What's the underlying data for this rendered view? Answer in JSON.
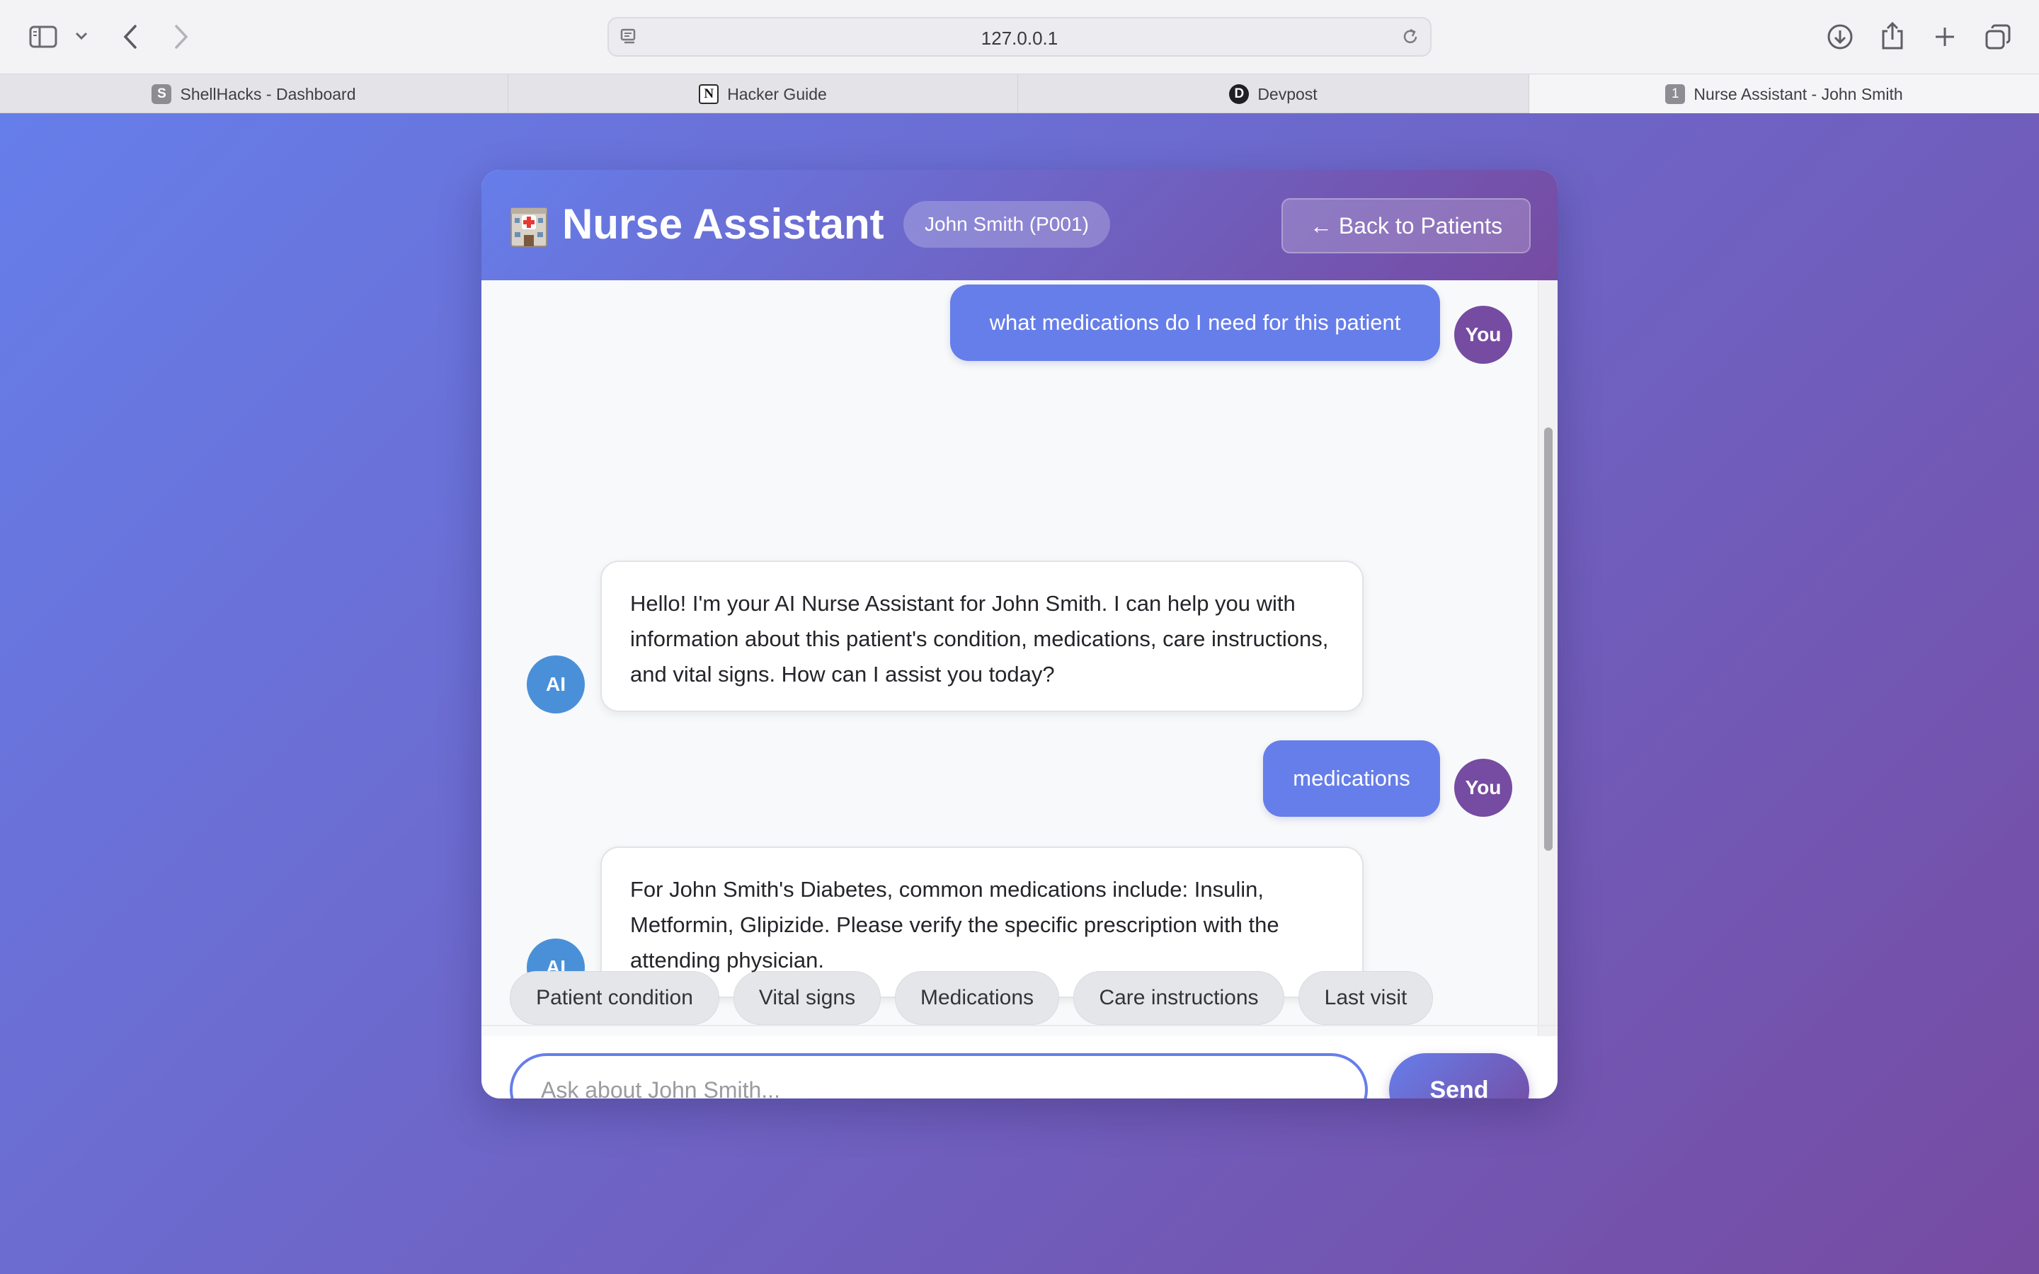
{
  "browser": {
    "url": "127.0.0.1",
    "tabs": [
      {
        "label": "ShellHacks - Dashboard",
        "icon": "shellhacks-favicon",
        "favicon_text": "S"
      },
      {
        "label": "Hacker Guide",
        "icon": "notion-favicon",
        "favicon_text": "N"
      },
      {
        "label": "Devpost",
        "icon": "devpost-favicon",
        "favicon_text": "D"
      },
      {
        "label": "Nurse Assistant - John Smith",
        "icon": "page-favicon",
        "favicon_text": "1",
        "active": true
      }
    ]
  },
  "header": {
    "icon": "hospital-icon",
    "title": "Nurse Assistant",
    "patient_badge": "John Smith (P001)",
    "back_label": "← Back to Patients"
  },
  "chat": {
    "messages": [
      {
        "role": "user",
        "avatar": "You",
        "text": "what medications do I need for this patient"
      },
      {
        "role": "ai",
        "avatar": "AI",
        "text": "Hello! I'm your AI Nurse Assistant for John Smith. I can help you with information about this patient's condition, medications, care instructions, and vital signs. How can I assist you today?"
      },
      {
        "role": "user",
        "avatar": "You",
        "text": "medications"
      },
      {
        "role": "ai",
        "avatar": "AI",
        "text": "For John Smith's Diabetes, common medications include: Insulin, Metformin, Glipizide. Please verify the specific prescription with the attending physician."
      }
    ]
  },
  "quick_actions": [
    "Patient condition",
    "Vital signs",
    "Medications",
    "Care instructions",
    "Last visit"
  ],
  "input": {
    "placeholder": "Ask about John Smith...",
    "value": "",
    "send_label": "Send"
  },
  "colors": {
    "gradient_start": "#667eea",
    "gradient_end": "#764ba2",
    "user_bubble": "#667eea",
    "user_avatar": "#764ba2",
    "ai_avatar": "#4a90d9"
  }
}
